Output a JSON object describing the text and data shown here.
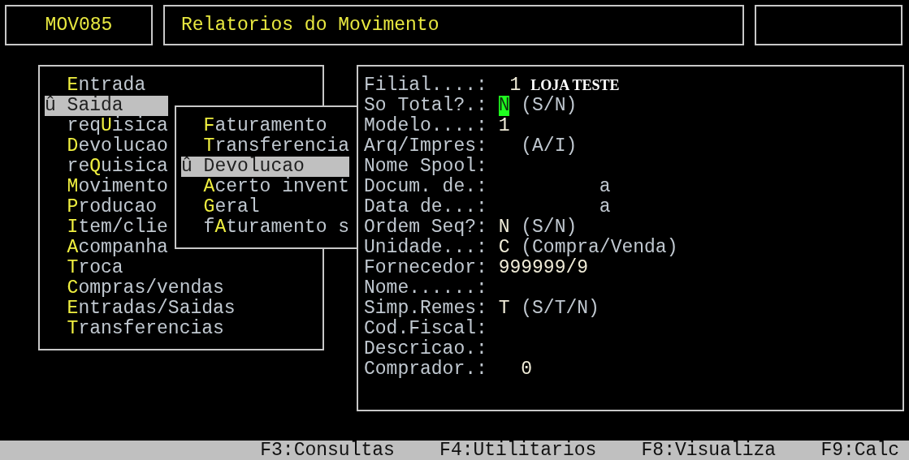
{
  "header": {
    "program_code": "MOV085",
    "title": "Relatorios do Movimento"
  },
  "menu": {
    "marker": "û",
    "items": [
      {
        "hotkey": "E",
        "after": "ntrada",
        "selected": false
      },
      {
        "hotkey": "S",
        "after": "aida",
        "selected": true
      },
      {
        "before": "req",
        "hotkey": "U",
        "after": "isica",
        "selected": false
      },
      {
        "hotkey": "D",
        "after": "evolucao",
        "selected": false
      },
      {
        "before": "re",
        "hotkey": "Q",
        "after": "uisica",
        "selected": false
      },
      {
        "hotkey": "M",
        "after": "ovimento",
        "selected": false
      },
      {
        "hotkey": "P",
        "after": "roducao",
        "selected": false
      },
      {
        "hotkey": "I",
        "after": "tem/clie",
        "selected": false
      },
      {
        "hotkey": "A",
        "after": "companha",
        "selected": false
      },
      {
        "hotkey": "T",
        "after": "roca",
        "selected": false
      },
      {
        "hotkey": "C",
        "after": "ompras/vendas",
        "selected": false
      },
      {
        "hotkey": "E",
        "after": "ntradas/Saidas",
        "selected": false
      },
      {
        "hotkey": "T",
        "after": "ransferencias",
        "selected": false
      }
    ]
  },
  "submenu": {
    "marker": "û",
    "items": [
      {
        "hotkey": "F",
        "after": "aturamento",
        "selected": false
      },
      {
        "hotkey": "T",
        "after": "ransferencia",
        "selected": false
      },
      {
        "hotkey": "D",
        "after": "evolucao",
        "selected": true
      },
      {
        "hotkey": "A",
        "after": "certo invent",
        "selected": false
      },
      {
        "hotkey": "G",
        "after": "eral",
        "selected": false
      },
      {
        "before": "f",
        "hotkey": "A",
        "after": "turamento s",
        "selected": false
      }
    ]
  },
  "form": {
    "fields": [
      {
        "kind": "branch",
        "label": "Filial....:",
        "value": "1",
        "name": "LOJA TESTE",
        "focused": false
      },
      {
        "kind": "flag",
        "label": "So Total?.:",
        "value": "N",
        "hint": "(S/N)",
        "focused": true
      },
      {
        "kind": "text",
        "label": "Modelo....:",
        "value": "1",
        "focused": false
      },
      {
        "kind": "flag",
        "label": "Arq/Impres:",
        "hint": "(A/I)",
        "focused": false
      },
      {
        "kind": "text",
        "label": "Nome Spool:",
        "focused": false
      },
      {
        "kind": "range",
        "label": "Docum. de.:",
        "to": "a",
        "focused": false
      },
      {
        "kind": "range",
        "label": "Data de...:",
        "to": "a",
        "focused": false
      },
      {
        "kind": "flag",
        "label": "Ordem Seq?:",
        "value": "N",
        "hint": "(S/N)",
        "focused": false
      },
      {
        "kind": "flag",
        "label": "Unidade...:",
        "value": "C",
        "hint": "(Compra/Venda)",
        "focused": false
      },
      {
        "kind": "text",
        "label": "Fornecedor:",
        "value": "999999/9",
        "focused": false
      },
      {
        "kind": "text",
        "label": "Nome......:",
        "focused": false
      },
      {
        "kind": "flag",
        "label": "Simp.Remes:",
        "value": "T",
        "hint": "(S/T/N)",
        "focused": false
      },
      {
        "kind": "text",
        "label": "Cod.Fiscal:",
        "focused": false
      },
      {
        "kind": "text",
        "label": "Descricao.:",
        "focused": false
      },
      {
        "kind": "number",
        "label": "Comprador.:",
        "value": "0",
        "focused": false
      }
    ]
  },
  "function_keys": [
    "F3:Consultas",
    "F4:Utilitarios",
    "F8:Visualiza",
    "F9:Calc"
  ]
}
